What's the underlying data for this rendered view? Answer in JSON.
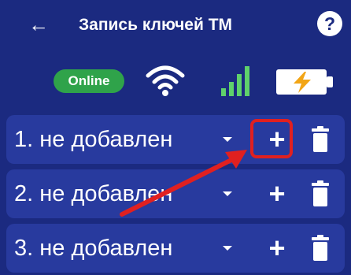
{
  "header": {
    "back_icon": "arrow-left-icon",
    "title": "Запись ключей ТМ",
    "help_label": "?"
  },
  "status": {
    "online_label": "Online",
    "wifi_icon": "wifi-icon",
    "signal_icon": "cellular-signal-icon",
    "battery_icon": "battery-charging-icon"
  },
  "slots": [
    {
      "label": "1. не добавлен"
    },
    {
      "label": "2. не добавлен"
    },
    {
      "label": "3. не добавлен"
    }
  ],
  "colors": {
    "background": "#1b2a80",
    "slot": "#283a9e",
    "online": "#2fa34a",
    "highlight": "#e02020"
  }
}
